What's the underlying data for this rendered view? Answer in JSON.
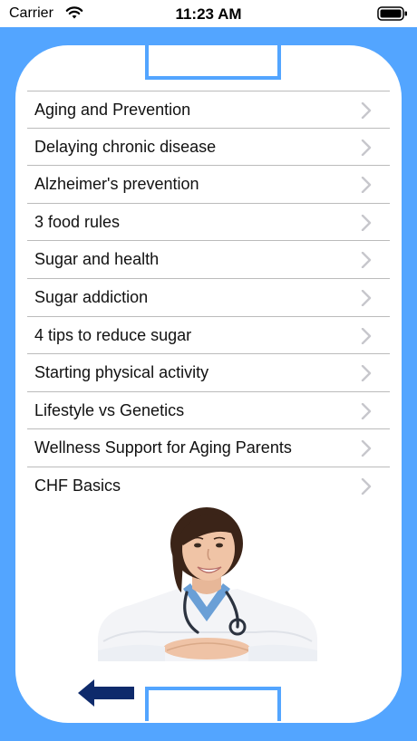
{
  "status_bar": {
    "carrier": "Carrier",
    "time": "11:23 AM"
  },
  "colors": {
    "background": "#53a5ff",
    "card": "#ffffff",
    "chevron": "#c7c7cc",
    "divider": "#bbbbbb",
    "back_arrow": "#0e2a6b"
  },
  "menu": {
    "items": [
      {
        "label": "Aging and Prevention",
        "icon": "chevron-right-icon"
      },
      {
        "label": "Delaying chronic disease",
        "icon": "chevron-right-icon"
      },
      {
        "label": "Alzheimer's prevention",
        "icon": "chevron-right-icon"
      },
      {
        "label": "3 food rules",
        "icon": "chevron-right-icon"
      },
      {
        "label": "Sugar and health",
        "icon": "chevron-right-icon"
      },
      {
        "label": "Sugar addiction",
        "icon": "chevron-right-icon"
      },
      {
        "label": "4 tips to reduce sugar",
        "icon": "chevron-right-icon"
      },
      {
        "label": "Starting physical activity",
        "icon": "chevron-right-icon"
      },
      {
        "label": "Lifestyle vs Genetics",
        "icon": "chevron-right-icon"
      },
      {
        "label": "Wellness Support for Aging Parents",
        "icon": "chevron-right-icon"
      },
      {
        "label": "CHF Basics",
        "icon": "chevron-right-icon"
      }
    ]
  },
  "footer": {
    "back_icon": "back-arrow-icon"
  }
}
